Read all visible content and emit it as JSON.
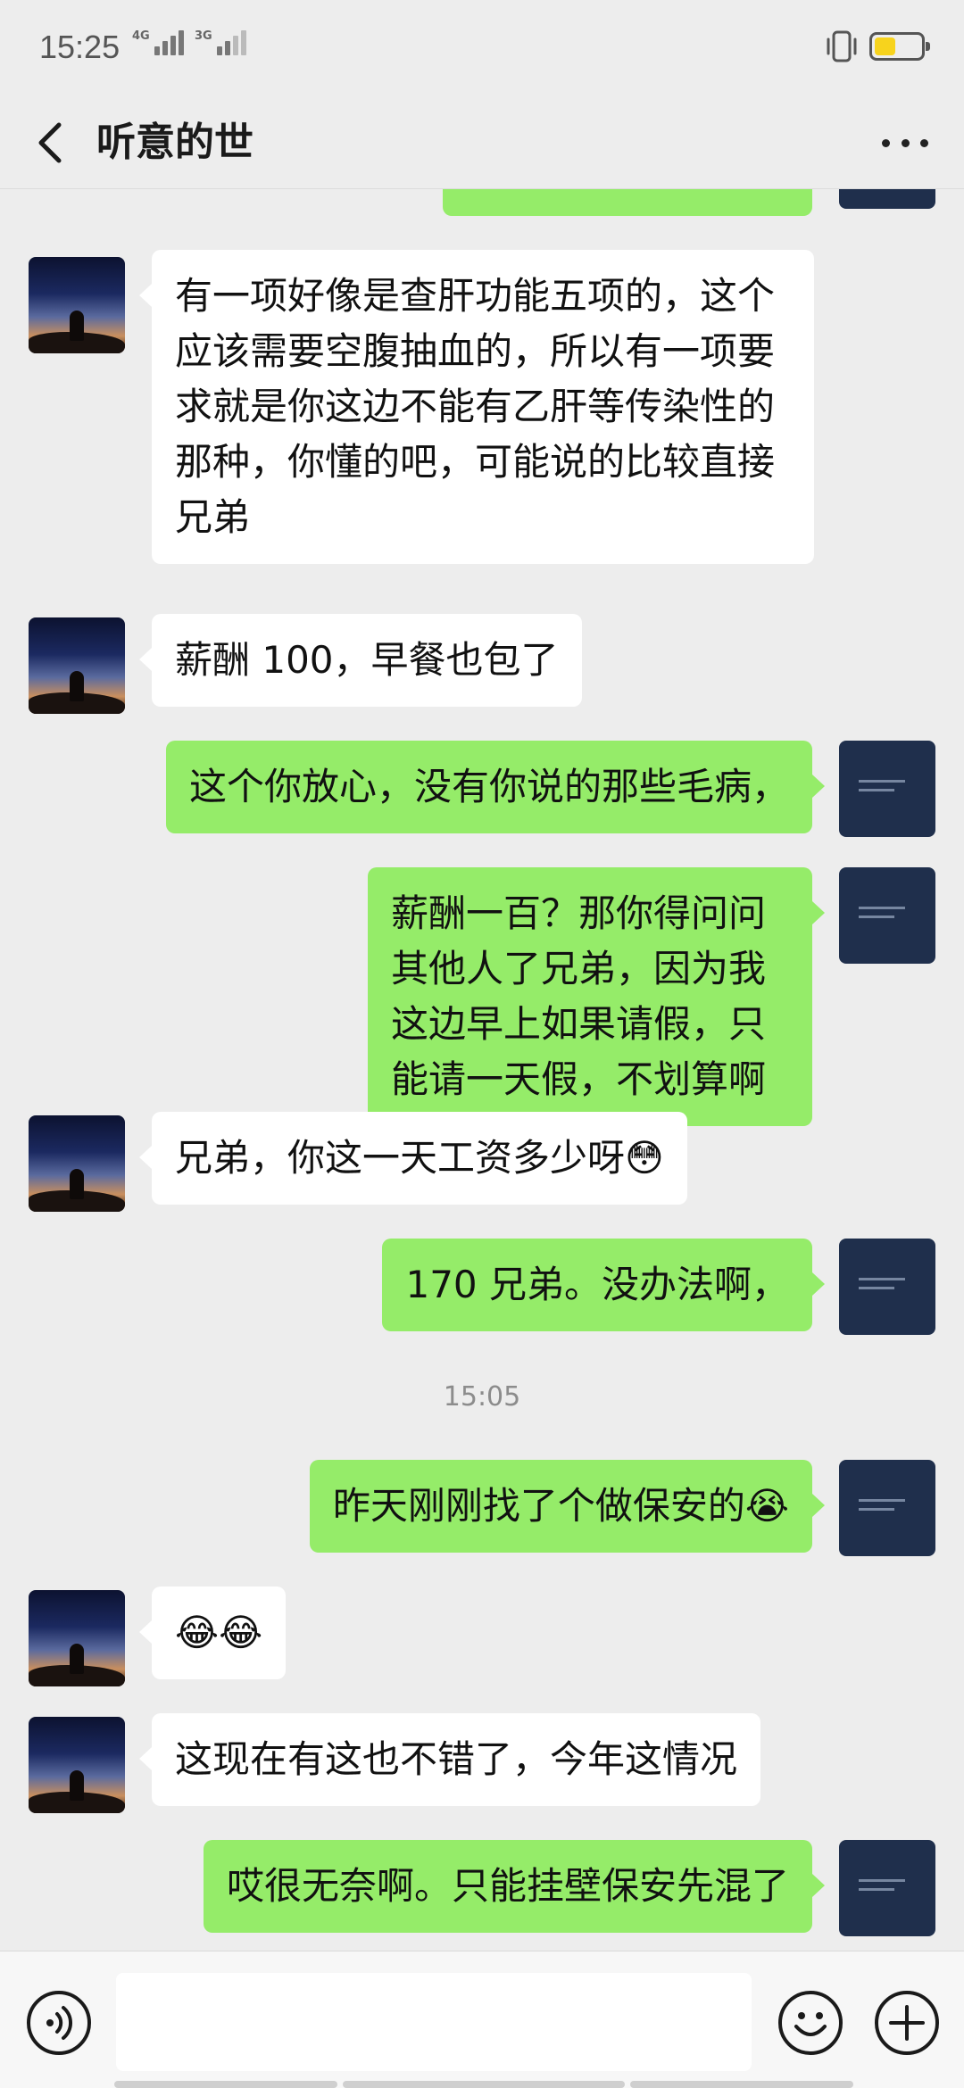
{
  "status_bar": {
    "time": "15:25",
    "signal_1": "4G",
    "signal_2": "3G",
    "battery_level": 0.45,
    "battery_color": "#f7d31d"
  },
  "header": {
    "back_icon": "chevron-left-icon",
    "title": "听意的世",
    "more_icon": "more-dots-icon"
  },
  "messages": [
    {
      "side": "right",
      "text": "",
      "partial": true
    },
    {
      "side": "left",
      "text": "有一项好像是查肝功能五项的，这个应该需要空腹抽血的，所以有一项要求就是你这边不能有乙肝等传染性的那种，你懂的吧，可能说的比较直接兄弟"
    },
    {
      "side": "left",
      "text": "薪酬 100，早餐也包了"
    },
    {
      "side": "right",
      "text": "这个你放心，没有你说的那些毛病，"
    },
    {
      "side": "right",
      "text": "薪酬一百？那你得问问其他人了兄弟，因为我这边早上如果请假，只能请一天假，不划算啊"
    },
    {
      "side": "left",
      "text": "兄弟，你这一天工资多少呀😳"
    },
    {
      "side": "right",
      "text": "170 兄弟。没办法啊，"
    },
    {
      "side": "time",
      "text": "15:05"
    },
    {
      "side": "right",
      "text": "昨天刚刚找了个做保安的😭"
    },
    {
      "side": "left",
      "text": "😂😂"
    },
    {
      "side": "left",
      "text": "这现在有这也不错了，今年这情况"
    },
    {
      "side": "right",
      "text": "哎很无奈啊。只能挂壁保安先混了"
    }
  ],
  "input_bar": {
    "voice_icon": "voice-icon",
    "input_value": "",
    "emoji_icon": "emoji-icon",
    "plus_icon": "plus-icon"
  }
}
